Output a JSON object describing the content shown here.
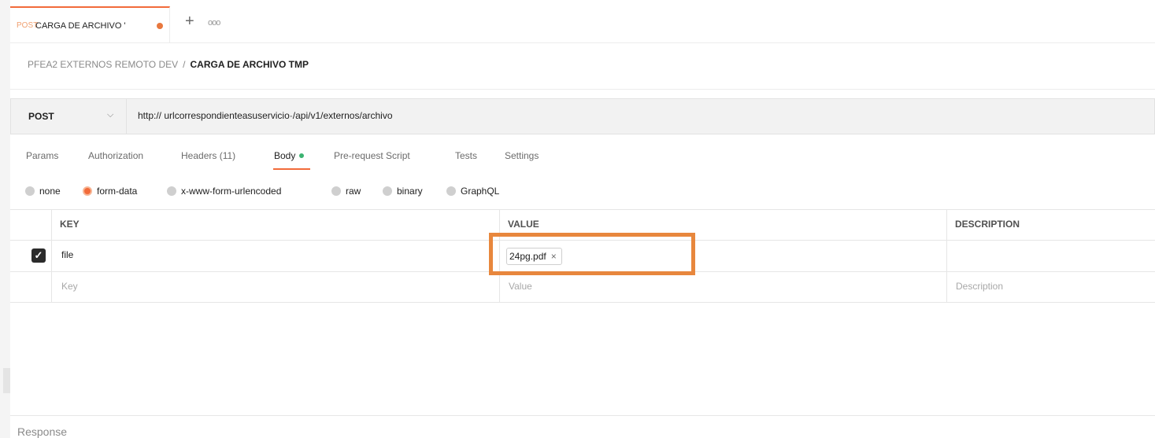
{
  "tab": {
    "method": "POST",
    "name": "CARGA DE ARCHIVO '",
    "add_icon": "+",
    "more_icon": "ooo"
  },
  "breadcrumb": {
    "collection": "PFEA2 EXTERNOS REMOTO DEV",
    "separator": "/",
    "request": "CARGA DE ARCHIVO TMP"
  },
  "request": {
    "method": "POST",
    "chevron": "⌵",
    "url": "http:// urlcorrespondienteasuservicio·/api/v1/externos/archivo"
  },
  "request_tabs": [
    {
      "label": "Params"
    },
    {
      "label": "Authorization"
    },
    {
      "label": "Headers (11)"
    },
    {
      "label": "Body"
    },
    {
      "label": "Pre-request Script"
    },
    {
      "label": "Tests"
    },
    {
      "label": "Settings"
    }
  ],
  "body_types": [
    {
      "label": "none",
      "selected": false
    },
    {
      "label": "form-data",
      "selected": true
    },
    {
      "label": "x-www-form-urlencoded",
      "selected": false
    },
    {
      "label": "raw",
      "selected": false
    },
    {
      "label": "binary",
      "selected": false
    },
    {
      "label": "GraphQL",
      "selected": false
    }
  ],
  "table": {
    "headers": {
      "key": "KEY",
      "value": "VALUE",
      "description": "DESCRIPTION"
    },
    "rows": [
      {
        "checked": true,
        "check_glyph": "✓",
        "key": "file",
        "value": "24pg.pdf",
        "remove": "×"
      }
    ],
    "placeholders": {
      "key": "Key",
      "value": "Value",
      "description": "Description"
    }
  },
  "colors": {
    "accent": "#f26b3a",
    "highlight": "#e8873d",
    "active_dot": "#3cb371"
  },
  "response": {
    "label": "Response"
  }
}
